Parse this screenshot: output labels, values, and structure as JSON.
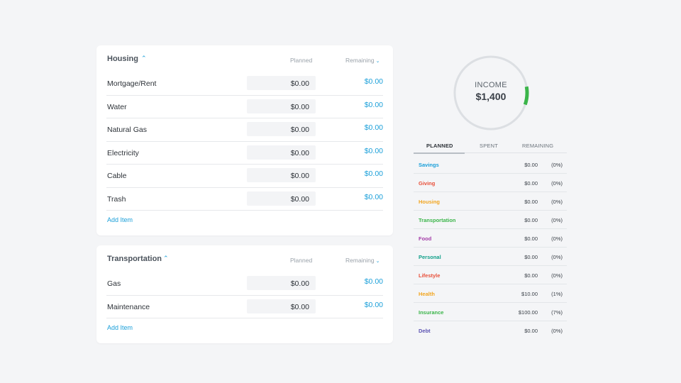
{
  "colors": {
    "accent": "#1a9fd9",
    "ring": "#dcdfe3",
    "ring_progress": "#3bb54a"
  },
  "housing": {
    "title": "Housing",
    "planned_header": "Planned",
    "remaining_header": "Remaining",
    "items": [
      {
        "label": "Mortgage/Rent",
        "planned": "$0.00",
        "remaining": "$0.00"
      },
      {
        "label": "Water",
        "planned": "$0.00",
        "remaining": "$0.00"
      },
      {
        "label": "Natural Gas",
        "planned": "$0.00",
        "remaining": "$0.00"
      },
      {
        "label": "Electricity",
        "planned": "$0.00",
        "remaining": "$0.00"
      },
      {
        "label": "Cable",
        "planned": "$0.00",
        "remaining": "$0.00"
      },
      {
        "label": "Trash",
        "planned": "$0.00",
        "remaining": "$0.00"
      }
    ],
    "add_item": "Add Item"
  },
  "transportation": {
    "title": "Transportation",
    "planned_header": "Planned",
    "remaining_header": "Remaining",
    "items": [
      {
        "label": "Gas",
        "planned": "$0.00",
        "remaining": "$0.00"
      },
      {
        "label": "Maintenance",
        "planned": "$0.00",
        "remaining": "$0.00"
      }
    ],
    "add_item": "Add Item"
  },
  "income": {
    "label": "INCOME",
    "value": "$1,400",
    "progress_fraction": 0.08
  },
  "summary": {
    "tabs": [
      "PLANNED",
      "SPENT",
      "REMAINING"
    ],
    "active_tab": "PLANNED",
    "rows": [
      {
        "name": "Savings",
        "amount": "$0.00",
        "pct": "(0%)",
        "color": "#1a9fd9"
      },
      {
        "name": "Giving",
        "amount": "$0.00",
        "pct": "(0%)",
        "color": "#e8503a"
      },
      {
        "name": "Housing",
        "amount": "$0.00",
        "pct": "(0%)",
        "color": "#f2a51f"
      },
      {
        "name": "Transportation",
        "amount": "$0.00",
        "pct": "(0%)",
        "color": "#3bb54a"
      },
      {
        "name": "Food",
        "amount": "$0.00",
        "pct": "(0%)",
        "color": "#a43ea8"
      },
      {
        "name": "Personal",
        "amount": "$0.00",
        "pct": "(0%)",
        "color": "#12a08a"
      },
      {
        "name": "Lifestyle",
        "amount": "$0.00",
        "pct": "(0%)",
        "color": "#e8503a"
      },
      {
        "name": "Health",
        "amount": "$10.00",
        "pct": "(1%)",
        "color": "#f2a51f"
      },
      {
        "name": "Insurance",
        "amount": "$100.00",
        "pct": "(7%)",
        "color": "#3bb54a"
      },
      {
        "name": "Debt",
        "amount": "$0.00",
        "pct": "(0%)",
        "color": "#5d54b3"
      }
    ]
  }
}
